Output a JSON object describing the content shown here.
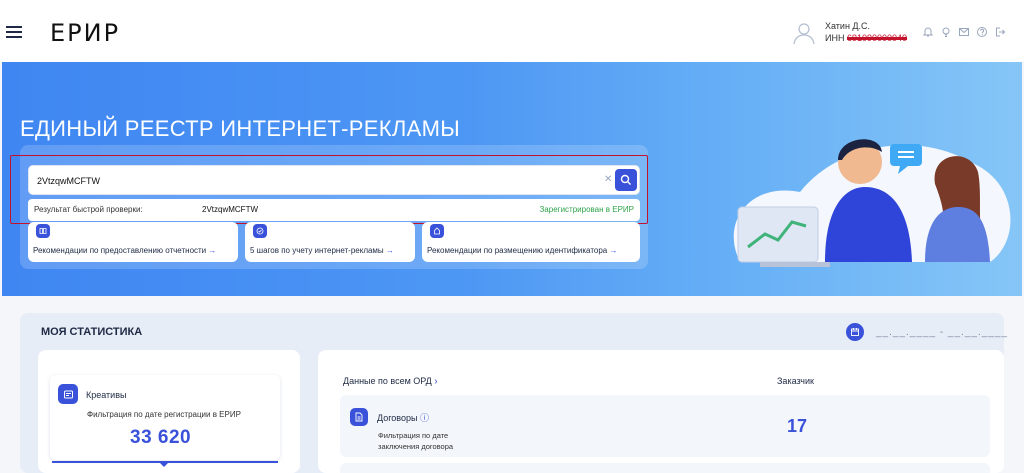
{
  "header": {
    "logo": "ЕРИР",
    "user": {
      "name": "Хатин Д.С.",
      "inn_label": "ИНН",
      "inn_value": "691090000040"
    },
    "icons": [
      "bell-icon",
      "lightbulb-icon",
      "mail-icon",
      "help-icon",
      "logout-icon"
    ]
  },
  "hero": {
    "title": "ЕДИНЫЙ РЕЕСТР ИНТЕРНЕТ-РЕКЛАМЫ",
    "search": {
      "value": "2VtzqwMCFTW",
      "placeholder": ""
    },
    "quick_check": {
      "label": "Результат быстрой проверки:",
      "value": "2VtzqwMCFTW",
      "status": "Зарегистрирован в ЕРИР"
    },
    "recommendations": [
      {
        "label": "Рекомендации по предоставлению отчетности",
        "icon": "book-icon"
      },
      {
        "label": "5 шагов по учету интернет-рекламы",
        "icon": "check-circle-icon"
      },
      {
        "label": "Рекомендации по размещению идентификатора",
        "icon": "tag-icon"
      }
    ],
    "arrow": "→"
  },
  "stats": {
    "title": "МОЯ СТАТИСТИКА",
    "date_range": "__.__.____ - __.__.____",
    "creatives": {
      "label": "Креативы",
      "filter": "Фильтрация по дате регистрации в ЕРИР",
      "value": "33 620"
    },
    "ord_link": "Данные по всем ОРД",
    "customer_col": "Заказчик",
    "contracts": {
      "label": "Договоры",
      "filter": "Фильтрация по дате заключения договора",
      "value": "17"
    }
  },
  "colors": {
    "accent": "#3a52d9",
    "success": "#2fa34b",
    "highlight": "#c3122b"
  }
}
